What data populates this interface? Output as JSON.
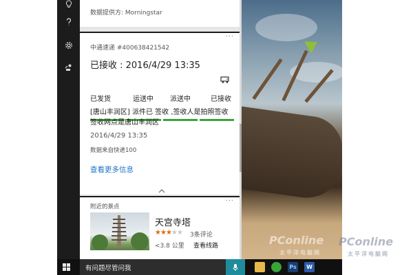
{
  "cortana": {
    "rail_icons": [
      "lightbulb-icon",
      "help-icon",
      "gear-icon",
      "feedback-icon"
    ],
    "data_provider": "数据提供方: Morningstar",
    "package": {
      "carrier_number": "中通速递 #400638421542",
      "status_line": "已接收 : 2016/4/29 13:35",
      "stages": [
        "已发货",
        "运送中",
        "派送中",
        "已接收"
      ],
      "detail_line1": "[唐山丰润区] 派件已 签收 ,签收人是拍照签收",
      "detail_line2": "签收网点是唐山丰润区",
      "timestamp": "2016/4/29 13:35",
      "source": "数据来自快递100",
      "more_link": "查看更多信息",
      "more_dots": "···"
    },
    "nearby": {
      "heading": "附近的景点",
      "name": "天宫寺塔",
      "rating": 3,
      "rating_max": 5,
      "reviews": "3条评论",
      "distance": "<3.8 公里",
      "directions": "查看线路"
    }
  },
  "taskbar": {
    "search_text": "有问题尽管问我",
    "apps": [
      "explorer",
      "browser",
      "photoshop",
      "word"
    ]
  },
  "watermarks": [
    "PConline",
    "PConline",
    "太平洋电脑网",
    "太平洋电脑网"
  ],
  "colors": {
    "progress": "#3aa33a",
    "link": "#1b74c7",
    "star": "#e06a00",
    "mic": "#1e8c9c"
  }
}
